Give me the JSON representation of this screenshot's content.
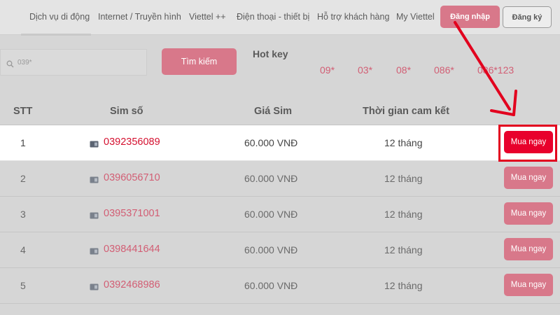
{
  "nav": {
    "items": [
      {
        "label": "Dịch vụ di động"
      },
      {
        "label": "Internet / Truyền hình"
      },
      {
        "label": "Viettel ++"
      },
      {
        "label": "Điện thoại - thiết bị"
      },
      {
        "label": "Hỗ trợ khách hàng"
      },
      {
        "label": "My Viettel"
      }
    ],
    "login_label": "Đăng nhập",
    "register_label": "Đăng ký"
  },
  "search": {
    "placeholder": "039*",
    "button_label": "Tìm kiếm"
  },
  "hotkey": {
    "title": "Hot key",
    "items": [
      "09*",
      "03*",
      "08*",
      "086*",
      "086*123"
    ]
  },
  "table": {
    "headers": {
      "stt": "STT",
      "sim": "Sim số",
      "price": "Giá Sim",
      "term": "Thời gian cam kết"
    },
    "buy_label": "Mua ngay",
    "rows": [
      {
        "stt": "1",
        "sim": "0392356089",
        "price": "60.000 VNĐ",
        "term": "12 tháng"
      },
      {
        "stt": "2",
        "sim": "0396056710",
        "price": "60.000 VNĐ",
        "term": "12 tháng"
      },
      {
        "stt": "3",
        "sim": "0395371001",
        "price": "60.000 VNĐ",
        "term": "12 tháng"
      },
      {
        "stt": "4",
        "sim": "0398441644",
        "price": "60.000 VNĐ",
        "term": "12 tháng"
      },
      {
        "stt": "5",
        "sim": "0392468986",
        "price": "60.000 VNĐ",
        "term": "12 tháng"
      }
    ]
  },
  "colors": {
    "accent": "#d8788a",
    "highlight_button": "#e8002c",
    "annotation": "#e2001e"
  }
}
